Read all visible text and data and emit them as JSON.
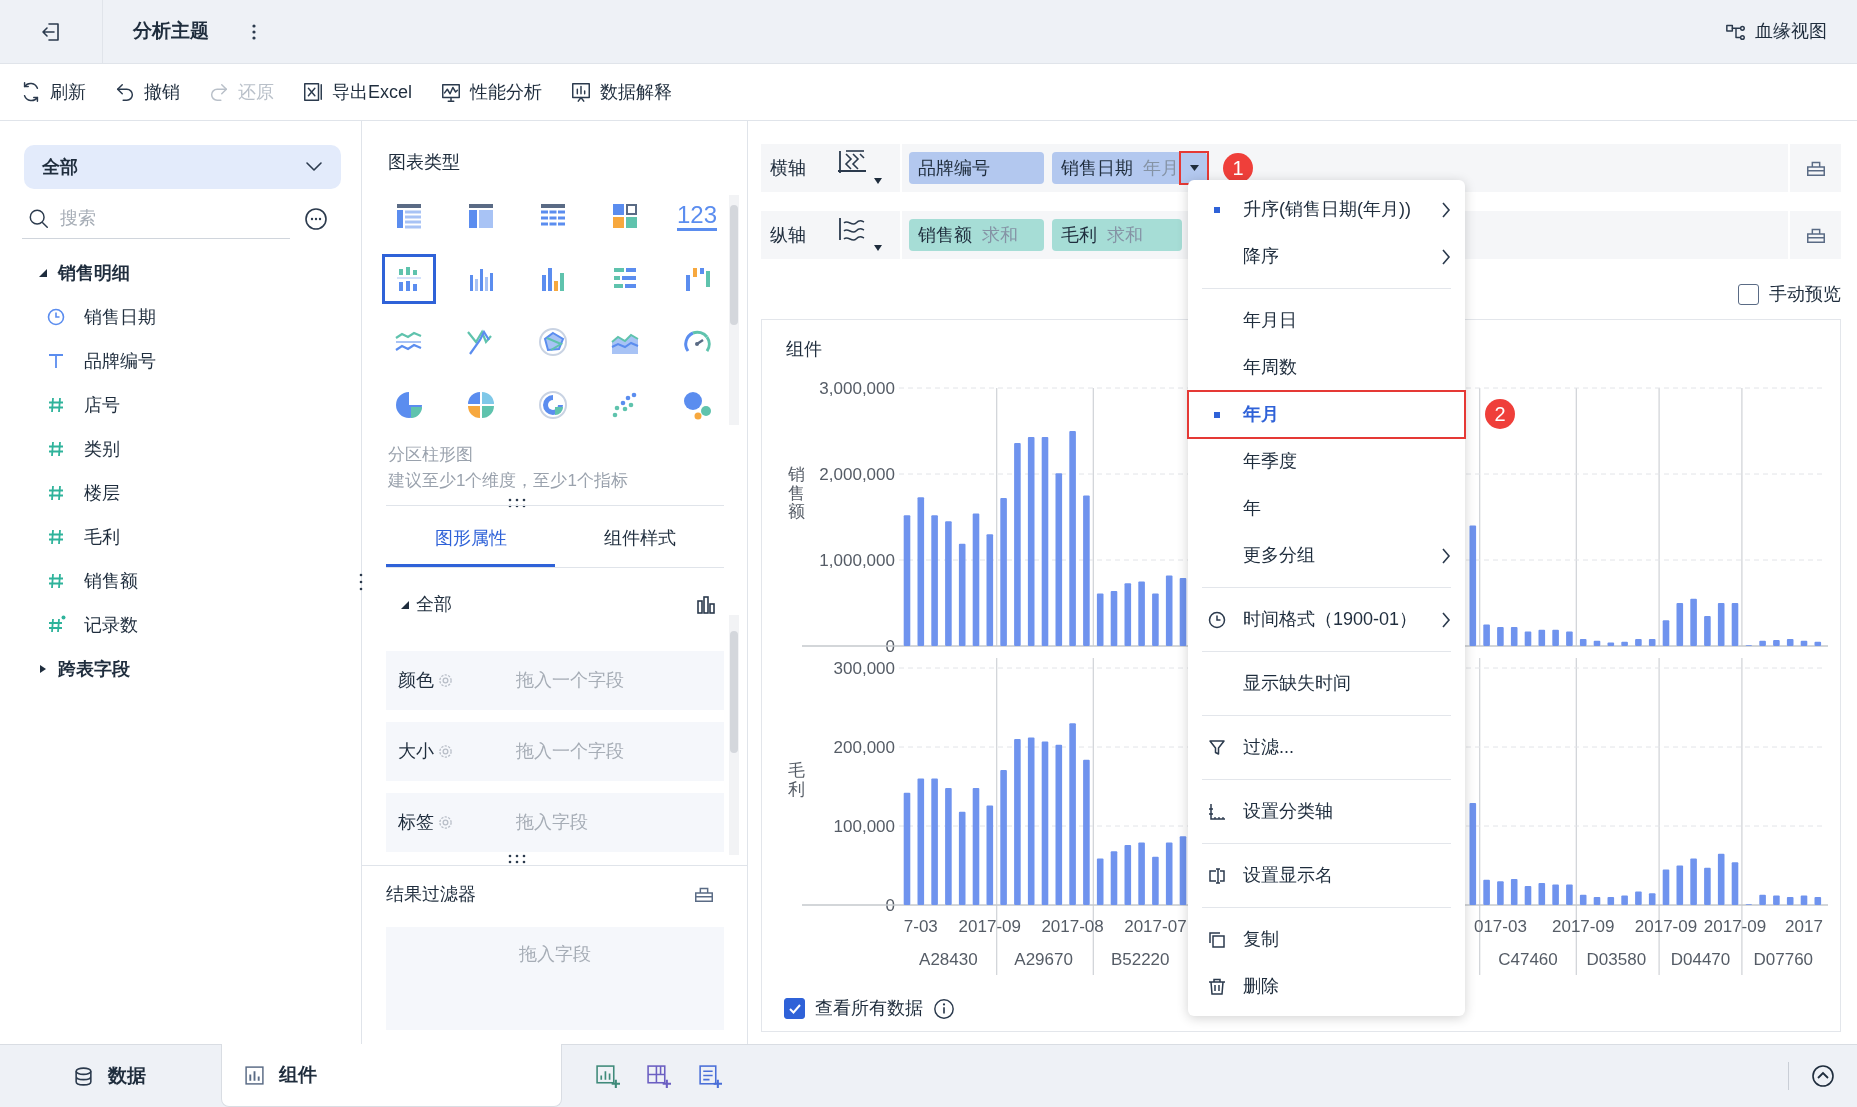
{
  "top_bar": {
    "title": "分析主题",
    "lineage_button": "血缘视图"
  },
  "toolbar": [
    {
      "label": "刷新",
      "disabled": false
    },
    {
      "label": "撤销",
      "disabled": false
    },
    {
      "label": "还原",
      "disabled": true
    },
    {
      "label": "导出Excel",
      "disabled": false
    },
    {
      "label": "性能分析",
      "disabled": false
    },
    {
      "label": "数据解释",
      "disabled": false
    }
  ],
  "data_panel": {
    "dataset_select": "全部",
    "search": {
      "placeholder": "搜索"
    },
    "tree": [
      {
        "label": "销售明细",
        "expanded": true,
        "children": [
          {
            "label": "销售日期",
            "kind": "date"
          },
          {
            "label": "品牌编号",
            "kind": "text"
          },
          {
            "label": "店号",
            "kind": "number"
          },
          {
            "label": "类别",
            "kind": "number"
          },
          {
            "label": "楼层",
            "kind": "number"
          },
          {
            "label": "毛利",
            "kind": "number"
          },
          {
            "label": "销售额",
            "kind": "number"
          },
          {
            "label": "记录数",
            "kind": "count"
          }
        ]
      },
      {
        "label": "跨表字段",
        "expanded": false
      }
    ]
  },
  "chart_types": {
    "title": "图表类型",
    "options": [
      {
        "kind": "table",
        "selected": false
      },
      {
        "kind": "crosstable",
        "selected": false
      },
      {
        "kind": "detail",
        "selected": false
      },
      {
        "kind": "dashboard",
        "selected": false
      },
      {
        "kind": "kpi",
        "label": "123",
        "selected": false
      },
      {
        "kind": "partition-bar",
        "selected": true
      },
      {
        "kind": "multi-bar",
        "selected": false
      },
      {
        "kind": "color-bar",
        "selected": false
      },
      {
        "kind": "hbar",
        "selected": false
      },
      {
        "kind": "waterfall",
        "selected": false
      },
      {
        "kind": "line",
        "selected": false
      },
      {
        "kind": "cross-line",
        "selected": false
      },
      {
        "kind": "radar",
        "selected": false
      },
      {
        "kind": "area",
        "selected": false
      },
      {
        "kind": "gauge",
        "selected": false
      },
      {
        "kind": "pie",
        "selected": false
      },
      {
        "kind": "multi-pie",
        "selected": false
      },
      {
        "kind": "donut",
        "selected": false
      },
      {
        "kind": "scatter",
        "selected": false
      },
      {
        "kind": "bubble",
        "selected": false
      }
    ],
    "description": "分区柱形图",
    "hint": "建议至少1个维度，至少1个指标"
  },
  "property_tabs": [
    {
      "label": "图形属性",
      "selected": true
    },
    {
      "label": "组件样式",
      "selected": false
    }
  ],
  "properties": {
    "section": "全部",
    "expanded": true,
    "rows": [
      {
        "label": "颜色",
        "placeholder": "拖入一个字段"
      },
      {
        "label": "大小",
        "placeholder": "拖入一个字段"
      },
      {
        "label": "标签",
        "placeholder": "拖入字段"
      }
    ]
  },
  "result_filter": {
    "title": "结果过滤器",
    "placeholder": "拖入字段"
  },
  "shelves": [
    {
      "label": "横轴",
      "kind": "dimension",
      "pills": [
        {
          "name": "品牌编号",
          "dropdown": false
        },
        {
          "name": "销售日期",
          "detail": "年月",
          "dropdown": true,
          "callout": "1"
        }
      ]
    },
    {
      "label": "纵轴",
      "kind": "measure",
      "pills": [
        {
          "name": "销售额",
          "detail": "求和",
          "dropdown": false
        },
        {
          "name": "毛利",
          "detail": "求和",
          "dropdown": false
        }
      ]
    }
  ],
  "manual_preview": {
    "label": "手动预览",
    "checked": false
  },
  "chart_card": {
    "title": "组件",
    "charts": [
      {
        "chart_data": {
          "type": "bar",
          "ylabel": "销售额",
          "ylim": [
            0,
            3000000
          ],
          "yticks": [
            {
              "value": 0,
              "label": "0"
            },
            {
              "value": 1000000,
              "label": "1,000,000"
            },
            {
              "value": 2000000,
              "label": "2,000,000"
            },
            {
              "value": 3000000,
              "label": "3,000,000"
            }
          ],
          "values": [
            1520000,
            1730000,
            1520000,
            1450000,
            1190000,
            1540000,
            1300000,
            1720000,
            2360000,
            2430000,
            2430000,
            2010000,
            2500000,
            1750000,
            610000,
            640000,
            730000,
            750000,
            610000,
            820000,
            790000,
            null,
            null,
            null,
            null,
            null,
            null,
            null,
            null,
            null,
            null,
            null,
            null,
            null,
            null,
            null,
            null,
            null,
            null,
            null,
            null,
            1400000,
            250000,
            220000,
            220000,
            170000,
            190000,
            190000,
            170000,
            80000,
            60000,
            40000,
            50000,
            80000,
            80000,
            300000,
            500000,
            550000,
            350000,
            500000,
            500000,
            10000,
            60000,
            70000,
            80000,
            60000,
            50000
          ]
        }
      },
      {
        "chart_data": {
          "type": "bar",
          "ylabel": "毛利",
          "ylim": [
            0,
            300000
          ],
          "yticks": [
            {
              "value": 0,
              "label": "0"
            },
            {
              "value": 100000,
              "label": "100,000"
            },
            {
              "value": 200000,
              "label": "200,000"
            },
            {
              "value": 300000,
              "label": "300,000"
            }
          ],
          "categories": [
            null,
            "7-03",
            null,
            null,
            null,
            null,
            "2017-09",
            null,
            null,
            null,
            null,
            null,
            "2017-08",
            null,
            null,
            null,
            null,
            null,
            "2017-07",
            null,
            null,
            null,
            null,
            null,
            null,
            null,
            null,
            null,
            null,
            null,
            null,
            null,
            null,
            null,
            null,
            null,
            null,
            null,
            null,
            null,
            null,
            null,
            null,
            "017-03",
            null,
            null,
            null,
            null,
            null,
            "2017-09",
            null,
            null,
            null,
            null,
            null,
            "2017-09",
            null,
            null,
            null,
            null,
            "2017-09",
            null,
            null,
            null,
            null,
            "2017",
            null
          ],
          "values": [
            142000,
            160000,
            160000,
            148000,
            118000,
            148000,
            126000,
            171000,
            210000,
            212000,
            207000,
            203000,
            230000,
            184000,
            59000,
            68000,
            76000,
            79000,
            61000,
            79000,
            87000,
            null,
            null,
            null,
            null,
            null,
            null,
            null,
            null,
            null,
            null,
            null,
            null,
            null,
            null,
            null,
            null,
            null,
            null,
            null,
            null,
            129000,
            32000,
            30000,
            33000,
            24000,
            28000,
            26000,
            26000,
            13000,
            10000,
            10000,
            12000,
            17000,
            15000,
            45000,
            50000,
            59000,
            47000,
            65000,
            54000,
            1000,
            13000,
            12000,
            10000,
            12000,
            10000
          ],
          "annotations": [
            {
              "text": "A28430"
            },
            {
              "text": "A29670"
            },
            {
              "text": "B52220"
            },
            {
              "text": "C47460"
            },
            {
              "text": "D03580"
            },
            {
              "text": "D04470"
            },
            {
              "text": "D07760"
            }
          ]
        }
      }
    ],
    "show_all": {
      "label": "查看所有数据",
      "checked": true
    }
  },
  "menu": {
    "items": [
      {
        "kind": "option",
        "label": "升序(销售日期(年月))",
        "checked": true,
        "selected": false,
        "submenu": true
      },
      {
        "kind": "option",
        "label": "降序",
        "checked": false,
        "selected": false,
        "submenu": true
      },
      {
        "kind": "separator"
      },
      {
        "kind": "option",
        "label": "年月日",
        "checked": false,
        "selected": false,
        "submenu": false
      },
      {
        "kind": "option",
        "label": "年周数",
        "checked": false,
        "selected": false,
        "submenu": false
      },
      {
        "kind": "option",
        "label": "年月",
        "checked": true,
        "selected": true,
        "submenu": false,
        "callout": "2"
      },
      {
        "kind": "option",
        "label": "年季度",
        "checked": false,
        "selected": false,
        "submenu": false
      },
      {
        "kind": "option",
        "label": "年",
        "checked": false,
        "selected": false,
        "submenu": false
      },
      {
        "kind": "option",
        "label": "更多分组",
        "checked": false,
        "selected": false,
        "submenu": true
      },
      {
        "kind": "separator"
      },
      {
        "kind": "format",
        "label": "时间格式（1900-01）",
        "submenu": true
      },
      {
        "kind": "separator"
      },
      {
        "kind": "option",
        "label": "显示缺失时间",
        "checked": false,
        "selected": false,
        "submenu": false
      },
      {
        "kind": "separator"
      },
      {
        "kind": "filter",
        "label": "过滤...",
        "submenu": false
      },
      {
        "kind": "separator"
      },
      {
        "kind": "axis",
        "label": "设置分类轴",
        "submenu": false
      },
      {
        "kind": "separator"
      },
      {
        "kind": "rename",
        "label": "设置显示名",
        "submenu": false
      },
      {
        "kind": "separator"
      },
      {
        "kind": "copy",
        "label": "复制",
        "submenu": false
      },
      {
        "kind": "delete",
        "label": "删除",
        "submenu": false
      }
    ]
  },
  "bottom_tabs": [
    {
      "label": "数据",
      "selected": false
    },
    {
      "label": "组件",
      "selected": true
    }
  ]
}
